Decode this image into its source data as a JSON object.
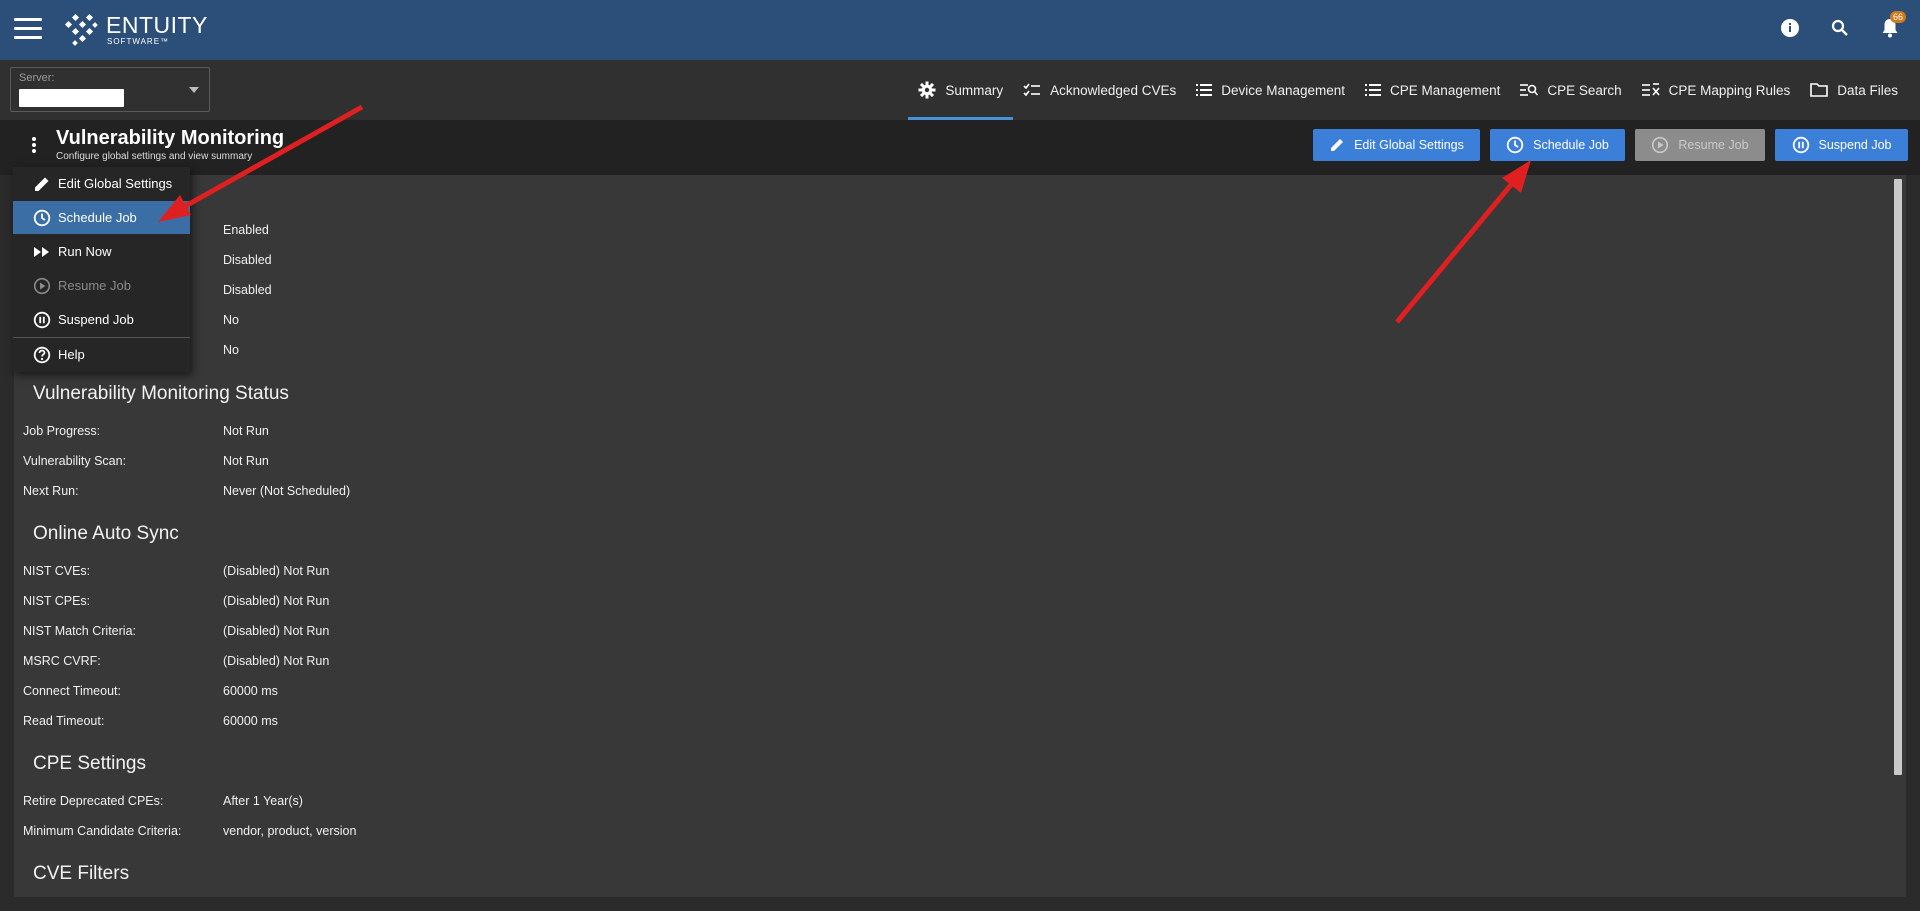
{
  "header": {
    "brand_name": "ENTUITY",
    "brand_sub": "SOFTWARE™",
    "notification_count": "66",
    "icons": [
      "hamburger-menu-icon",
      "info-icon",
      "search-icon",
      "bell-icon"
    ],
    "bar_color": "#2c4f7a"
  },
  "server": {
    "label": "Server:"
  },
  "tabs": [
    {
      "label": "Summary",
      "icon": "gear-icon",
      "active": true
    },
    {
      "label": "Acknowledged CVEs",
      "icon": "checklist-icon"
    },
    {
      "label": "Device Management",
      "icon": "list-icon"
    },
    {
      "label": "CPE Management",
      "icon": "list-icon"
    },
    {
      "label": "CPE Search",
      "icon": "search-list-icon"
    },
    {
      "label": "CPE Mapping Rules",
      "icon": "mapping-list-icon"
    },
    {
      "label": "Data Files",
      "icon": "folder-icon"
    }
  ],
  "page": {
    "title": "Vulnerability Monitoring",
    "subtitle": "Configure global settings and view summary"
  },
  "buttons": {
    "edit_global": "Edit Global Settings",
    "schedule_job": "Schedule Job",
    "resume_job": "Resume Job",
    "suspend_job": "Suspend Job",
    "accent": "#3b7fd9"
  },
  "menu": {
    "items": [
      {
        "label": "Edit Global Settings",
        "icon": "pencil-icon"
      },
      {
        "label": "Schedule Job",
        "icon": "clock-icon",
        "active": true
      },
      {
        "label": "Run Now",
        "icon": "fast-forward-icon"
      },
      {
        "label": "Resume Job",
        "icon": "play-circle-icon",
        "disabled": true
      },
      {
        "label": "Suspend Job",
        "icon": "pause-circle-icon"
      },
      {
        "label": "Help",
        "icon": "help-icon"
      }
    ]
  },
  "global_settings": {
    "values": [
      "Enabled",
      "Disabled",
      "Disabled",
      "No",
      "No"
    ]
  },
  "status": {
    "title": "Vulnerability Monitoring Status",
    "rows": [
      {
        "label": "Job Progress:",
        "value": "Not Run"
      },
      {
        "label": "Vulnerability Scan:",
        "value": "Not Run"
      },
      {
        "label": "Next Run:",
        "value": "Never (Not Scheduled)"
      }
    ]
  },
  "sync": {
    "title": "Online Auto Sync",
    "rows": [
      {
        "label": "NIST CVEs:",
        "value": "(Disabled) Not Run"
      },
      {
        "label": "NIST CPEs:",
        "value": "(Disabled) Not Run"
      },
      {
        "label": "NIST Match Criteria:",
        "value": "(Disabled) Not Run"
      },
      {
        "label": "MSRC CVRF:",
        "value": "(Disabled) Not Run"
      },
      {
        "label": "Connect Timeout:",
        "value": "60000 ms"
      },
      {
        "label": "Read Timeout:",
        "value": "60000 ms"
      }
    ]
  },
  "cpe": {
    "title": "CPE Settings",
    "rows": [
      {
        "label": "Retire Deprecated CPEs:",
        "value": "After 1 Year(s)"
      },
      {
        "label": "Minimum Candidate Criteria:",
        "value": "vendor, product, version"
      }
    ]
  },
  "cve_filters": {
    "title": "CVE Filters"
  },
  "annotation": {
    "arrow_color": "#e02020"
  }
}
